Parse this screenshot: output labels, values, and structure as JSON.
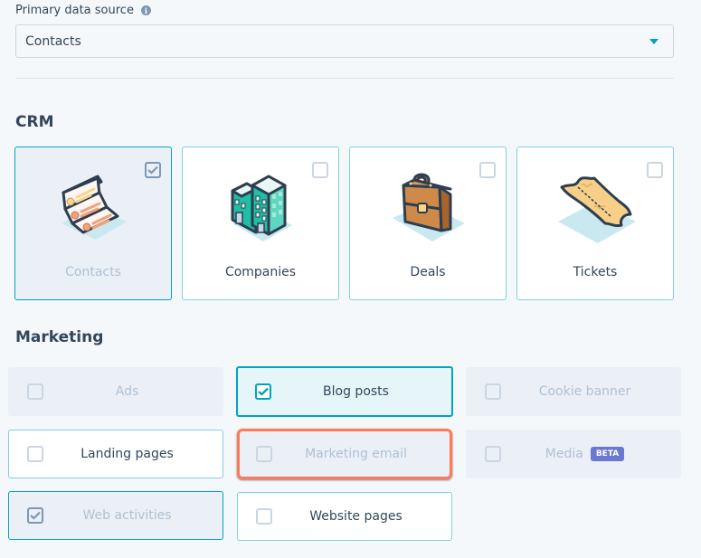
{
  "primary_source": {
    "label": "Primary data source",
    "info_icon": "info-icon",
    "selected": "Contacts"
  },
  "sections": {
    "crm": {
      "title": "CRM",
      "items": [
        {
          "label": "Contacts",
          "icon": "contacts-cards-icon",
          "checked": true,
          "state": "selected"
        },
        {
          "label": "Companies",
          "icon": "buildings-icon",
          "checked": false,
          "state": "normal"
        },
        {
          "label": "Deals",
          "icon": "briefcase-icon",
          "checked": false,
          "state": "normal"
        },
        {
          "label": "Tickets",
          "icon": "ticket-icon",
          "checked": false,
          "state": "normal"
        }
      ]
    },
    "marketing": {
      "title": "Marketing",
      "items": [
        {
          "label": "Ads",
          "checked": false,
          "state": "disabled"
        },
        {
          "label": "Blog posts",
          "checked": true,
          "state": "active"
        },
        {
          "label": "Cookie banner",
          "checked": false,
          "state": "disabled"
        },
        {
          "label": "Landing pages",
          "checked": false,
          "state": "normal"
        },
        {
          "label": "Marketing email",
          "checked": false,
          "state": "disabled-highlighted"
        },
        {
          "label": "Media",
          "checked": false,
          "state": "disabled",
          "badge": "BETA"
        },
        {
          "label": "Web activities",
          "checked": true,
          "state": "muted-selected"
        },
        {
          "label": "Website pages",
          "checked": false,
          "state": "normal"
        }
      ]
    }
  },
  "colors": {
    "accent": "#00a4bd",
    "highlight": "#ff7a59",
    "beta_badge": "#6a78d1",
    "text": "#33475b",
    "muted_text": "#b0c1d4"
  }
}
